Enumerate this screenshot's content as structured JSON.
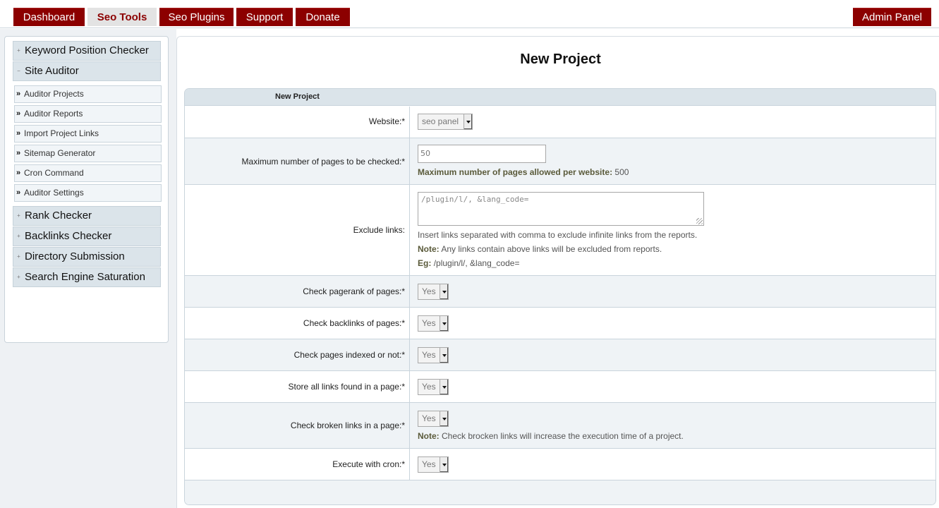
{
  "nav": {
    "tabs": [
      {
        "label": "Dashboard",
        "active": false
      },
      {
        "label": "Seo Tools",
        "active": true
      },
      {
        "label": "Seo Plugins",
        "active": false
      },
      {
        "label": "Support",
        "active": false
      },
      {
        "label": "Donate",
        "active": false
      }
    ],
    "admin_label": "Admin Panel"
  },
  "sidebar": {
    "groups": [
      {
        "label": "Keyword Position Checker",
        "expanded": false
      },
      {
        "label": "Site Auditor",
        "expanded": true
      },
      {
        "label": "Rank Checker",
        "expanded": false
      },
      {
        "label": "Backlinks Checker",
        "expanded": false
      },
      {
        "label": "Directory Submission",
        "expanded": false
      },
      {
        "label": "Search Engine Saturation",
        "expanded": false
      }
    ],
    "site_auditor_items": [
      "Auditor Projects",
      "Auditor Reports",
      "Import Project Links",
      "Sitemap Generator",
      "Cron Command",
      "Auditor Settings"
    ],
    "expand_glyph": "+",
    "collapse_glyph": "−",
    "item_glyph": "»"
  },
  "main": {
    "title": "New Project",
    "form_header": "New Project",
    "website": {
      "label": "Website:*",
      "value": "seo panel"
    },
    "max_pages": {
      "label": "Maximum number of pages to be checked:*",
      "value": "50",
      "note_bold": "Maximum number of pages allowed per website:",
      "note_value": "500"
    },
    "exclude_links": {
      "label": "Exclude links:",
      "placeholder": "/plugin/l/, &lang_code=",
      "help": "Insert links separated with comma to exclude infinite links from the reports.",
      "note_label": "Note:",
      "note_text": "Any links contain above links will be excluded from reports.",
      "eg_label": "Eg:",
      "eg_text": "/plugin/l/, &lang_code="
    },
    "check_pagerank": {
      "label": "Check pagerank of pages:*",
      "value": "Yes"
    },
    "check_backlinks": {
      "label": "Check backlinks of pages:*",
      "value": "Yes"
    },
    "check_indexed": {
      "label": "Check pages indexed or not:*",
      "value": "Yes"
    },
    "store_links": {
      "label": "Store all links found in a page:*",
      "value": "Yes"
    },
    "check_broken": {
      "label": "Check broken links in a page:*",
      "value": "Yes",
      "note_label": "Note:",
      "note_text": "Check brocken links will increase the execution time of a project."
    },
    "execute_cron": {
      "label": "Execute with cron:*",
      "value": "Yes"
    }
  }
}
